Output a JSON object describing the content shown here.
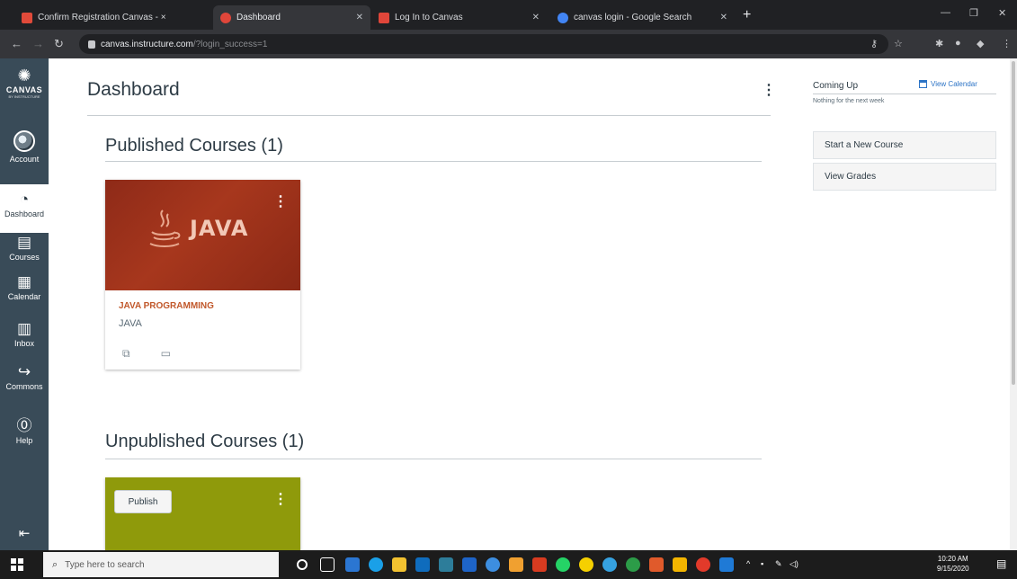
{
  "browser": {
    "tabs": [
      {
        "label": "Confirm Registration Canvas - ×",
        "favicon_color": "#e04a3a",
        "active": false
      },
      {
        "label": "Dashboard",
        "favicon_color": "#e0463a",
        "active": true
      },
      {
        "label": "Log In to Canvas",
        "favicon_color": "#e0463a",
        "active": false
      },
      {
        "label": "canvas login - Google Search",
        "favicon_color": "#4285f4",
        "active": false
      }
    ],
    "url_host": "canvas.instructure.com",
    "url_path": "/?login_success=1"
  },
  "global_nav": {
    "logo_word": "CANVAS",
    "logo_sub": "BY INSTRUCTURE",
    "items": [
      {
        "label": "Account",
        "icon": "account-avatar"
      },
      {
        "label": "Dashboard",
        "icon": "dashboard-icon",
        "active": true
      },
      {
        "label": "Courses",
        "icon": "courses-icon"
      },
      {
        "label": "Calendar",
        "icon": "calendar-icon"
      },
      {
        "label": "Inbox",
        "icon": "inbox-icon"
      },
      {
        "label": "Commons",
        "icon": "commons-icon"
      },
      {
        "label": "Help",
        "icon": "help-icon"
      }
    ]
  },
  "main": {
    "title": "Dashboard",
    "published_title": "Published Courses (1)",
    "unpublished_title": "Unpublished Courses (1)",
    "published_card": {
      "hero_text": "JAVA",
      "course_name": "JAVA PROGRAMMING",
      "course_code": "JAVA",
      "hero_color": "#9c321b",
      "name_color": "#c1582b"
    },
    "unpublished_card": {
      "publish_label": "Publish",
      "hero_color": "#8f9a0b"
    }
  },
  "sidebar": {
    "coming_up": "Coming Up",
    "view_calendar": "View Calendar",
    "nothing_text": "Nothing for the next week",
    "buttons": [
      "Start a New Course",
      "View Grades"
    ]
  },
  "taskbar": {
    "search_placeholder": "Type here to search",
    "time": "10:20 AM",
    "date": "9/15/2020"
  },
  "colors": {
    "nav_bg": "#394b58",
    "link": "#2d74c6"
  }
}
